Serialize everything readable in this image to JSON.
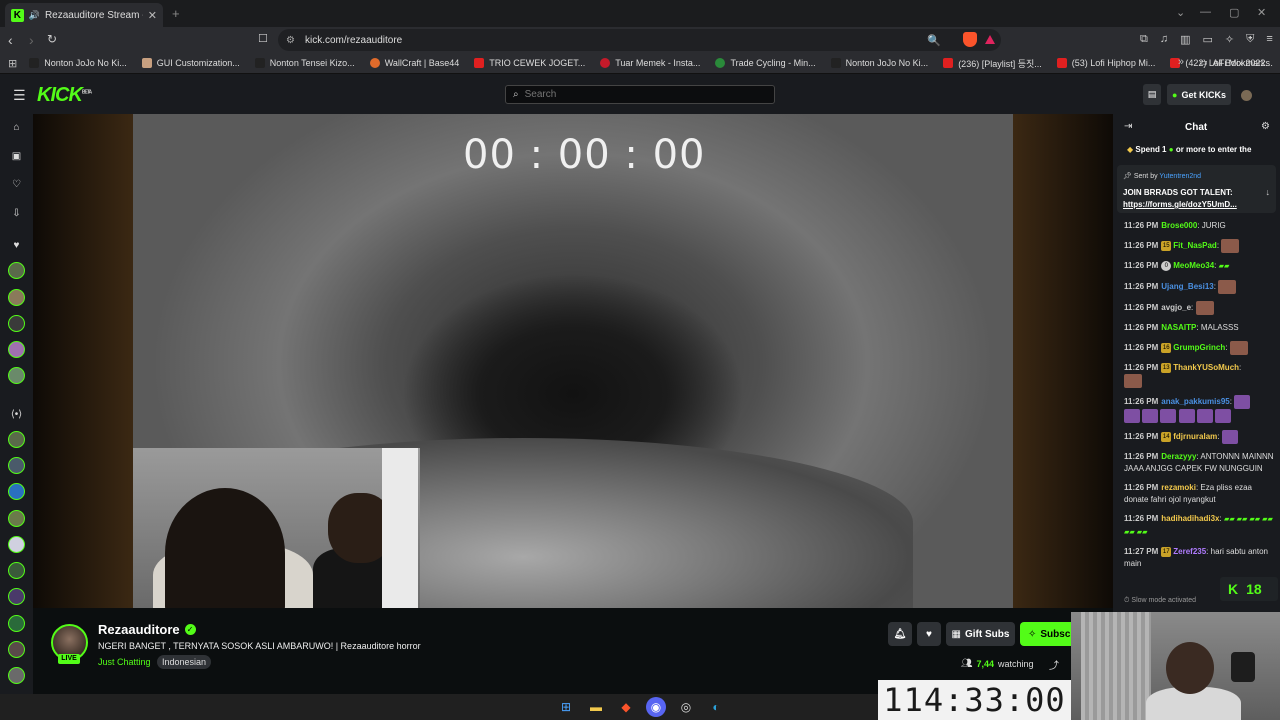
{
  "browser": {
    "tab_title": "Rezaauditore Stream - Watch",
    "url": "kick.com/rezaauditore",
    "bookmarks": [
      "Nonton JoJo No Ki...",
      "GUI Customization...",
      "Nonton Tensei Kizo...",
      "WallCraft | Base44",
      "TRIO CEWEK JOGET...",
      "Tuar Memek - Insta...",
      "Trade Cycling - Min...",
      "Nonton JoJo No Ki...",
      "(236) [Playlist] 등짓...",
      "(53) Lofi Hiphop Mi...",
      "(422) LoFi Mix 2022..."
    ],
    "all_bookmarks": "All Bookmarks"
  },
  "header": {
    "logo": "KICK",
    "logo_sup": "BETA",
    "search_placeholder": "Search",
    "get_kicks": "Get KICKs"
  },
  "video": {
    "timer": "00 : 00 : 00"
  },
  "stream": {
    "channel": "Rezaauditore",
    "live": "LIVE",
    "title": "NGERI BANGET , TERNYATA SOSOK ASLI AMBARUWO! | Rezaauditore horror",
    "category": "Just Chatting",
    "tag": "Indonesian",
    "gift_subs": "Gift Subs",
    "subscribe": "Subscribe",
    "viewers": "7,44",
    "watching": "watching"
  },
  "chat": {
    "title": "Chat",
    "spend_prefix": "Spend 1",
    "spend_suffix": "or more to enter the",
    "pinned_sent_by": "Sent by",
    "pinned_user": "Yutentren2nd",
    "pinned_line1": "JOIN BRRADS GOT TALENT:",
    "pinned_line2": "https://forms.gle/dozY5UmD...",
    "messages": [
      {
        "time": "11:26 PM",
        "user": "Brose000",
        "color": "#53fc18",
        "text": ": JURIG"
      },
      {
        "time": "11:26 PM",
        "user": "Fit_NasPad",
        "color": "#53fc18",
        "text": ":"
      },
      {
        "time": "11:26 PM",
        "user": "MeoMeo34",
        "color": "#53fc18",
        "text": ":"
      },
      {
        "time": "11:26 PM",
        "user": "Ujang_Besi13",
        "color": "#4a90e2",
        "text": ":"
      },
      {
        "time": "11:26 PM",
        "user": "avgjo_e",
        "color": "#ccc",
        "text": ":"
      },
      {
        "time": "11:26 PM",
        "user": "NASAITP",
        "color": "#53fc18",
        "text": ": MALASSS"
      },
      {
        "time": "11:26 PM",
        "user": "GrumpGrinch",
        "color": "#53fc18",
        "text": ":"
      },
      {
        "time": "11:26 PM",
        "user": "ThankYUSoMuch",
        "color": "#f2c94c",
        "text": ":"
      },
      {
        "time": "11:26 PM",
        "user": "anak_pakkumis95",
        "color": "#4a90e2",
        "text": ":"
      },
      {
        "time": "11:26 PM",
        "user": "fdjrnuralam",
        "color": "#f2c94c",
        "text": ":"
      },
      {
        "time": "11:26 PM",
        "user": "Derazyyy",
        "color": "#53fc18",
        "text": ": ANTONNN MAINNN JAAA ANJGG CAPEK FW NUNGGUIN"
      },
      {
        "time": "11:26 PM",
        "user": "rezamoki",
        "color": "#f2c94c",
        "text": ": Eza pliss ezaa donate fahri ojol nyangkut"
      },
      {
        "time": "11:26 PM",
        "user": "hadihadihadi3x",
        "color": "#f2c94c",
        "text": ":"
      },
      {
        "time": "11:27 PM",
        "user": "Zeref235",
        "color": "#b07cff",
        "text": ": hari sabtu anton main"
      }
    ],
    "slow_mode": "Slow mode activated",
    "k18": "18"
  },
  "overlay": {
    "bigtimer": "114:33:00"
  },
  "colors": {
    "accent": "#53fc18",
    "background": "#0b0e0f"
  }
}
